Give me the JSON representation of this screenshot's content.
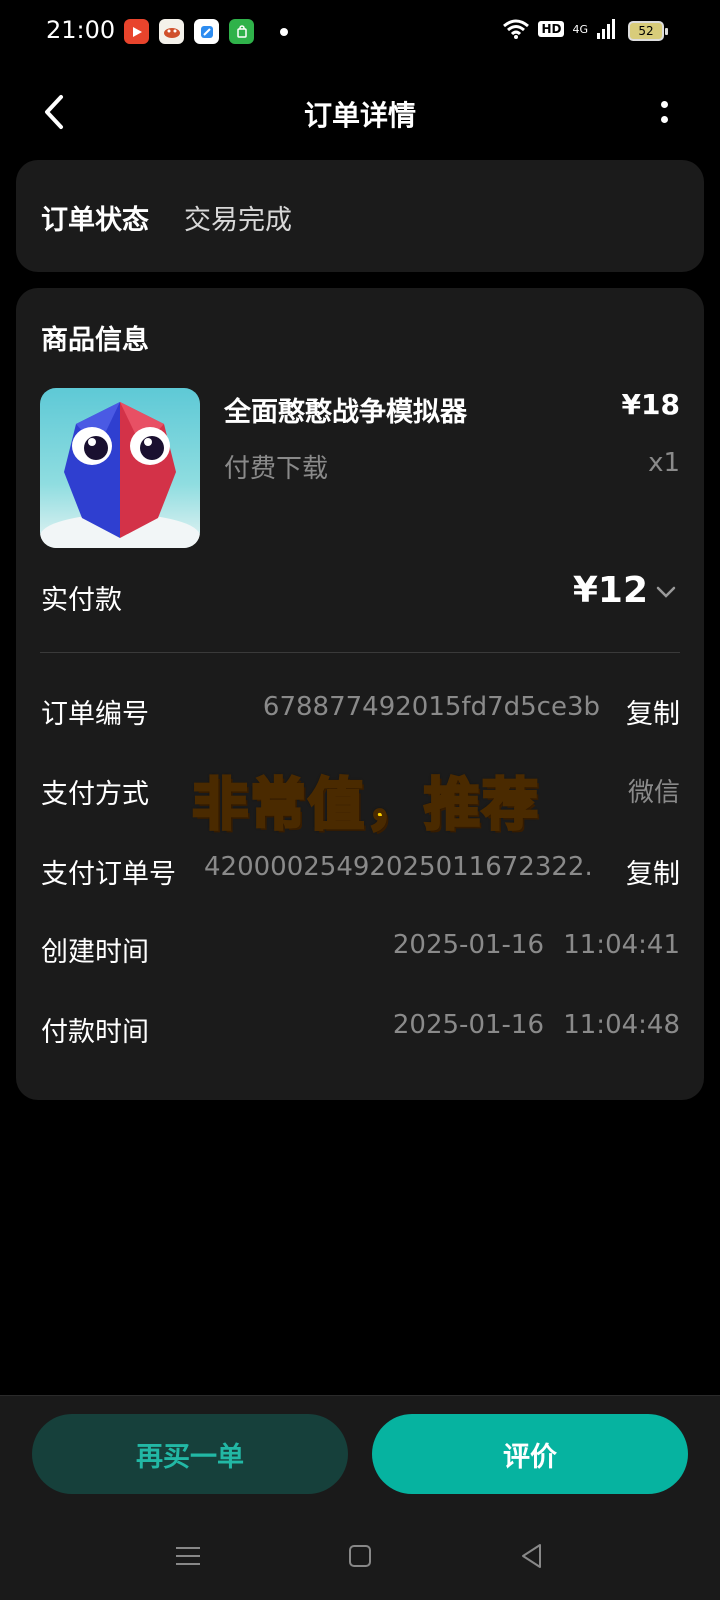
{
  "status_bar": {
    "time": "21:00",
    "hd_label": "HD",
    "network_label": "4G",
    "battery_level": "52",
    "notification_icons": [
      "video-app-icon",
      "game-app-icon",
      "browser-app-icon",
      "store-app-icon"
    ]
  },
  "header": {
    "title": "订单详情"
  },
  "order_status": {
    "label": "订单状态",
    "value": "交易完成"
  },
  "product_section": {
    "title": "商品信息",
    "name": "全面憨憨战争模拟器",
    "price": "¥18",
    "type": "付费下载",
    "quantity": "x1"
  },
  "payment": {
    "paid_label": "实付款",
    "paid_value": "¥12"
  },
  "details": {
    "order_no_label": "订单编号",
    "order_no_value": "678877492015fd7d5ce3b",
    "copy_label": "复制",
    "pay_method_label": "支付方式",
    "pay_method_value": "微信",
    "pay_order_no_label": "支付订单号",
    "pay_order_no_value": "420000254920250116723​22...",
    "created_label": "创建时间",
    "created_date": "2025-01-16",
    "created_time": "11:04:41",
    "paid_time_label": "付款时间",
    "paid_date": "2025-01-16",
    "paid_time": "11:04:48"
  },
  "overlay": {
    "text": "非常值，推荐"
  },
  "actions": {
    "rebuy_label": "再买一单",
    "review_label": "评价"
  },
  "colors": {
    "accent": "#06b3a0",
    "accent_dark": "#16403b",
    "card_bg": "#1b1b1b",
    "overlay_yellow": "#ffd400"
  }
}
